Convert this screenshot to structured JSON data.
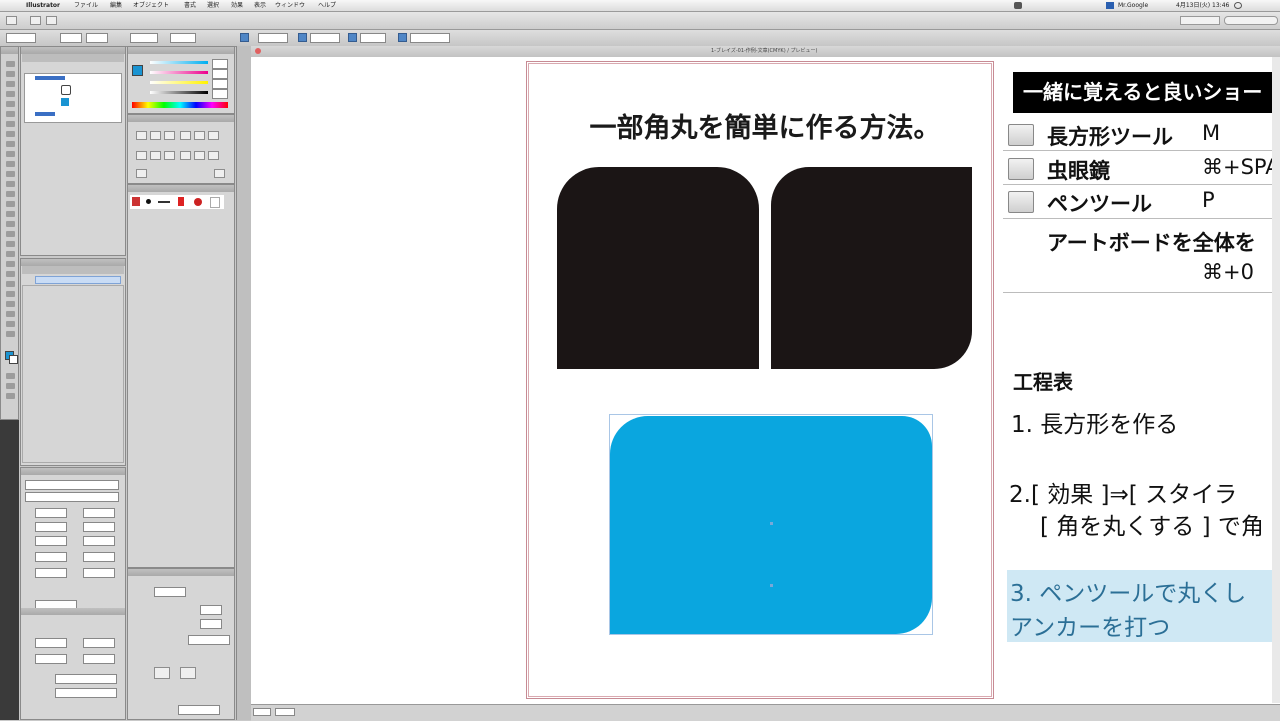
{
  "menubar": {
    "app": "Illustrator",
    "items": [
      "ファイル",
      "編集",
      "オブジェクト",
      "書式",
      "選択",
      "効果",
      "表示",
      "ウィンドウ",
      "ヘルプ"
    ],
    "status_right": "4月13日(火) 13:46",
    "user": "Mr.Google"
  },
  "document": {
    "tab_title": "1-ブレイズ-01-作例-文章(CMYK) / プレビュー)"
  },
  "artboard": {
    "title": "一部角丸を簡単に作る方法。"
  },
  "sheet": {
    "header": "一緒に覚えると良いショー",
    "shortcuts": [
      {
        "label": "長方形ツール",
        "key": "M",
        "icon": "rectangle-tool-icon"
      },
      {
        "label": "虫眼鏡",
        "key": "⌘+SPA",
        "icon": "zoom-tool-icon"
      },
      {
        "label": "ペンツール",
        "key": "P",
        "icon": "pen-tool-icon"
      },
      {
        "label": "アートボードを全体を",
        "key": "⌘+0",
        "icon": ""
      }
    ],
    "process_title": "工程表",
    "steps": [
      "1. 長方形を作る",
      "2.[ 効果 ]⇒[ スタイラ",
      "[ 角を丸くする ] で角",
      "3. ペンツールで丸くし",
      "アンカーを打つ"
    ]
  },
  "colors": {
    "accent_blue": "#0aa6df",
    "shape_dark": "#1b1515",
    "step_highlight": "#cfe8f4"
  }
}
